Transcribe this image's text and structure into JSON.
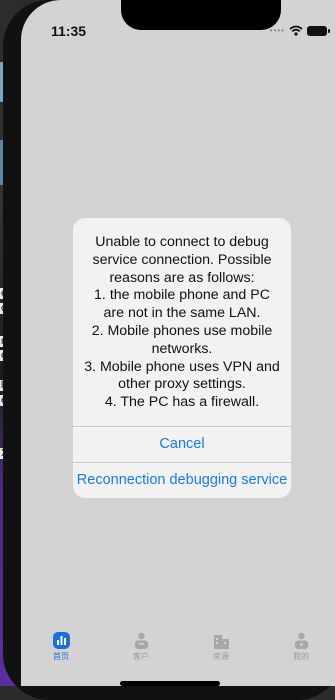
{
  "status_bar": {
    "time": "11:35"
  },
  "dialog": {
    "message": "Unable to connect to debug service connection. Possible reasons are as follows:\n1. the mobile phone and PC are not in the same LAN.\n2. Mobile phones use mobile networks.\n3. Mobile phone uses VPN and other proxy settings.\n4. The PC has a firewall.",
    "cancel_label": "Cancel",
    "reconnect_label": "Reconnection debugging service"
  },
  "tabbar": {
    "items": [
      {
        "label": "首页",
        "icon": "chart-icon",
        "active": true
      },
      {
        "label": "客户",
        "icon": "person-icon",
        "active": false
      },
      {
        "label": "房源",
        "icon": "building-icon",
        "active": false
      },
      {
        "label": "我的",
        "icon": "profile-icon",
        "active": false
      }
    ]
  },
  "colors": {
    "accent": "#1a7ae0",
    "tab_active": "#1e6fd6",
    "tab_inactive": "#9a9a9a"
  },
  "background_window": {
    "fragments": [
      "e",
      "or",
      "r",
      "e",
      "le",
      "ed",
      "X"
    ]
  }
}
